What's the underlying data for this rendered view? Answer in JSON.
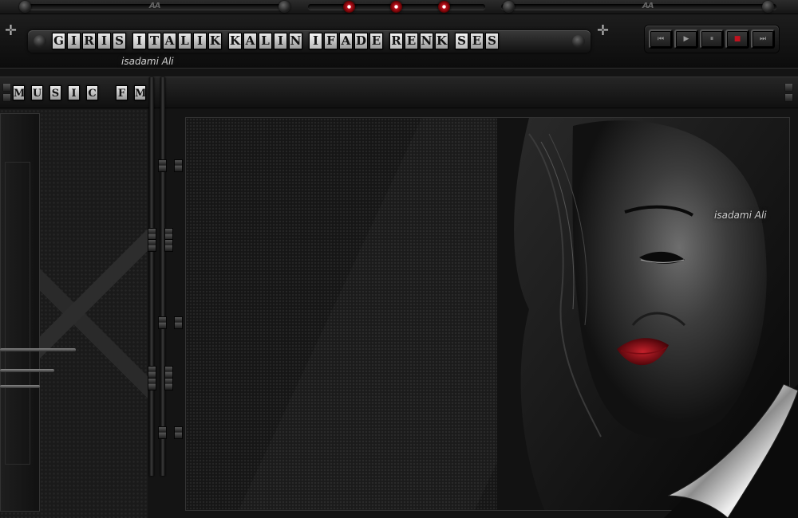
{
  "rail": {
    "logo_left": "AA",
    "logo_right": "AA"
  },
  "nav": {
    "items": [
      {
        "label": "GIRIS",
        "tiles": [
          "G",
          "I",
          "R",
          "I",
          "S"
        ]
      },
      {
        "label": "ITALIK",
        "tiles": [
          "I",
          "T",
          "A",
          "L",
          "I",
          "K"
        ]
      },
      {
        "label": "KALIN",
        "tiles": [
          "K",
          "A",
          "L",
          "I",
          "N"
        ]
      },
      {
        "label": "IFADE",
        "tiles": [
          "I",
          "F",
          "A",
          "D",
          "E"
        ]
      },
      {
        "label": "RENK",
        "tiles": [
          "R",
          "E",
          "N",
          "K"
        ]
      },
      {
        "label": "SES",
        "tiles": [
          "S",
          "E",
          "S"
        ]
      }
    ]
  },
  "signature": "isadami Ali",
  "station": {
    "title": "MUSIC FM",
    "tiles": [
      "M",
      "U",
      "S",
      "I",
      "C",
      " ",
      "F",
      "M"
    ]
  },
  "player": {
    "prev": "⏮",
    "play": "▶",
    "pause": "⏸",
    "stop": "■",
    "next": "⏭"
  },
  "colors": {
    "accent_red": "#c1121f",
    "chrome": "#2a2a2a",
    "panel": "#161616"
  }
}
